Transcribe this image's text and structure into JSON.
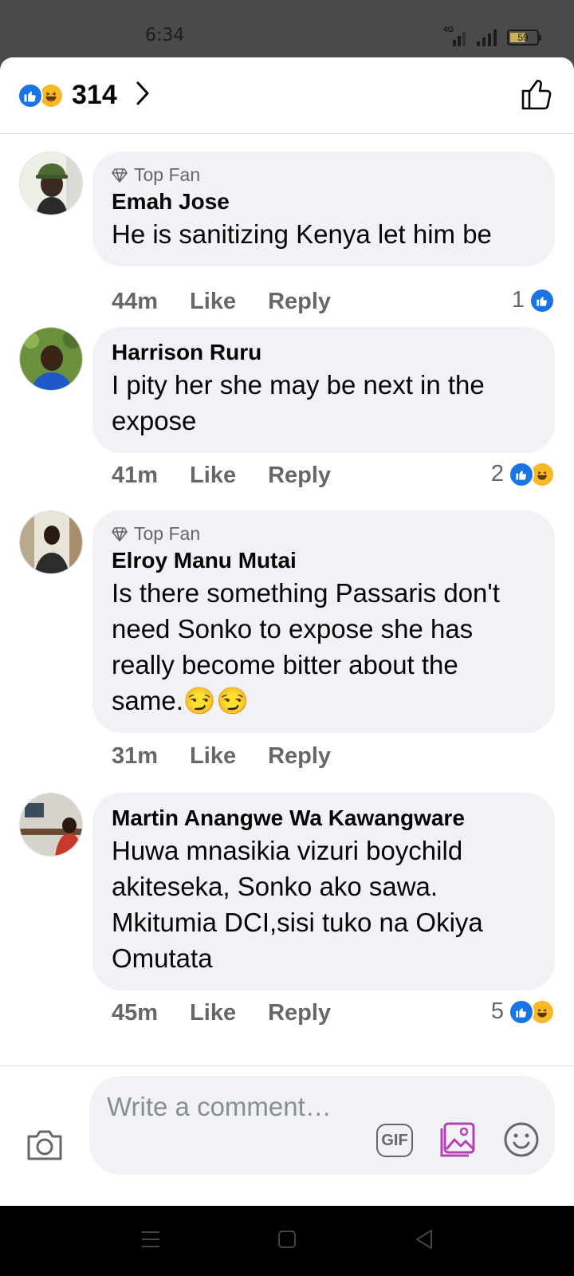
{
  "status_bar": {
    "time": "6:34",
    "network": "4G",
    "battery": "59",
    "battery_level": 0.59
  },
  "header": {
    "reaction_count": "314",
    "reaction_icons": [
      "like-icon",
      "haha-icon"
    ]
  },
  "comments": [
    {
      "badge": "Top Fan",
      "author": "Emah Jose",
      "text": "He is sanitizing Kenya let him be",
      "time": "44m",
      "like_label": "Like",
      "reply_label": "Reply",
      "reaction_count": "1",
      "reactions": [
        "like-icon"
      ]
    },
    {
      "badge": "",
      "author": "Harrison Ruru",
      "text": "I pity her she may be next in the expose",
      "time": "41m",
      "like_label": "Like",
      "reply_label": "Reply",
      "reaction_count": "2",
      "reactions": [
        "like-icon",
        "haha-icon"
      ]
    },
    {
      "badge": "Top Fan",
      "author": "Elroy Manu Mutai",
      "text": "Is there something Passaris don't need Sonko to expose she has really become bitter about the same.😏😏",
      "time": "31m",
      "like_label": "Like",
      "reply_label": "Reply",
      "reaction_count": "",
      "reactions": []
    },
    {
      "badge": "",
      "author": "Martin Anangwe Wa Kawangware",
      "text": "Huwa mnasikia vizuri boychild akiteseka, Sonko ako sawa. Mkitumia DCI,sisi tuko na Okiya Omutata",
      "time": "45m",
      "like_label": "Like",
      "reply_label": "Reply",
      "reaction_count": "5",
      "reactions": [
        "like-icon",
        "haha-icon"
      ]
    }
  ],
  "composer": {
    "placeholder": "Write a comment…",
    "gif_label": "GIF"
  },
  "colors": {
    "like_blue": "#1b74e4",
    "haha_yellow": "#f7b928",
    "bubble_bg": "#f0f2f5",
    "meta_gray": "#65676b"
  }
}
